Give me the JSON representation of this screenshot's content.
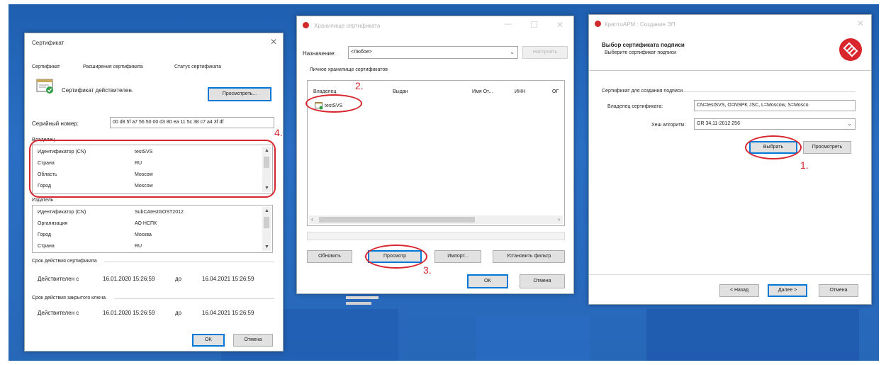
{
  "colors": {
    "desktop": "#2767b8",
    "accent": "#0078d7",
    "annotation": "#d8262e"
  },
  "win1": {
    "title": "Сертификат",
    "close_icon": "close-icon",
    "tabs": [
      "Сертификат",
      "Расширения сертификата",
      "Статус сертификата"
    ],
    "status_text": "Сертификат действителен.",
    "view_button": "Просмотреть...",
    "serial_label": "Серийный номер:",
    "serial_value": "00 d8 5f a7 56 50 00 d3 80 ea 11 5c 38 c7 a4 3f df",
    "owner_header": "Владелец",
    "owner_rows": [
      {
        "k": "Идентификатор (CN)",
        "v": "testSVS"
      },
      {
        "k": "Страна",
        "v": "RU"
      },
      {
        "k": "Область",
        "v": "Moscow"
      },
      {
        "k": "Город",
        "v": "Moscow"
      }
    ],
    "issuer_header": "Издатель",
    "issuer_rows": [
      {
        "k": "Идентификатор (CN)",
        "v": "SubCAtestGOST2012"
      },
      {
        "k": "Организация",
        "v": "АО НСПК"
      },
      {
        "k": "Город",
        "v": "Москва"
      },
      {
        "k": "Страна",
        "v": "RU"
      }
    ],
    "validity_header": "Срок действия сертификата",
    "validity": {
      "from_label": "Действителен с",
      "from": "16.01.2020 15:26:59",
      "to_label": "до",
      "to": "16.04.2021 15:26:59"
    },
    "key_validity_header": "Срок действия закрытого ключа",
    "key_validity": {
      "from_label": "Действителен с",
      "from": "16.01.2020 15:26:59",
      "to_label": "до",
      "to": "16.04.2021 15:26:59"
    },
    "ok_button": "OK",
    "cancel_button": "Отмена"
  },
  "win2": {
    "title": "Хранилище сертификата",
    "purpose_label": "Назначение:",
    "purpose_value": "<Любое>",
    "configure_button": "Настроить",
    "store_label": "Личное хранилище сертификатов",
    "columns": [
      "Владелец",
      "Выдан",
      "Имя От...",
      "ИНН",
      "ОГ"
    ],
    "items": [
      "testSVS"
    ],
    "refresh_button": "Обновить",
    "view_button": "Просмотр",
    "import_button": "Импорт...",
    "filter_button": "Установить фильтр",
    "ok_button": "OK",
    "cancel_button": "Отмена"
  },
  "win3": {
    "title": "КриптоАРМ : Создание ЭП",
    "header_title": "Выбор сертификата подписи",
    "header_subtitle": "Выберите сертификат подписи",
    "group_label": "Сертификат для создания подписи",
    "owner_label": "Владелец сертификата:",
    "owner_value": "CN=testSVS, O=NSPK JSC, L=Moscow, S=Mosco",
    "hash_label": "Хеш алгоритм:",
    "hash_value": "GR 34.11-2012 256",
    "select_button": "Выбрать",
    "view_button": "Просмотреть",
    "back_button": "< Назад",
    "next_button": "Далее >",
    "cancel_button": "Отмена"
  },
  "annotations": [
    "1.",
    "2.",
    "3.",
    "4."
  ]
}
